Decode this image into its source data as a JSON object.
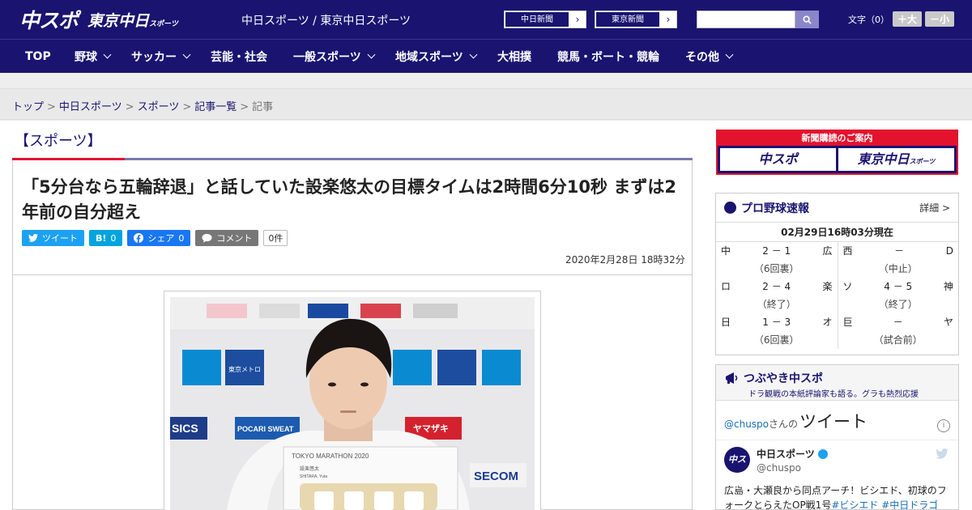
{
  "header": {
    "logo_main": "中スポ",
    "logo_sub": "東京中日",
    "logo_sub_small": "スポーツ",
    "site_title": "中日スポーツ / 東京中日スポーツ",
    "buttons": [
      {
        "label": "中日新聞",
        "arrow": "›"
      },
      {
        "label": "東京新聞",
        "arrow": "›"
      }
    ],
    "search_placeholder": "",
    "font_label": "文字（0）",
    "font_bigger": "＋大",
    "font_smaller": "－小"
  },
  "nav": {
    "items": [
      {
        "label": "TOP",
        "has_menu": false
      },
      {
        "label": "野球",
        "has_menu": true
      },
      {
        "label": "サッカー",
        "has_menu": true
      },
      {
        "label": "芸能・社会",
        "has_menu": false
      },
      {
        "label": "一般スポーツ",
        "has_menu": true
      },
      {
        "label": "地域スポーツ",
        "has_menu": true
      },
      {
        "label": "大相撲",
        "has_menu": false
      },
      {
        "label": "競馬・ボート・競輪",
        "has_menu": false
      },
      {
        "label": "その他",
        "has_menu": true
      }
    ]
  },
  "breadcrumb": {
    "items": [
      "トップ",
      "中日スポーツ",
      "スポーツ",
      "記事一覧"
    ],
    "current": "記事",
    "separator": ">"
  },
  "article": {
    "section": "【スポーツ】",
    "headline": "「5分台なら五輪辞退」と話していた設楽悠太の目標タイムは2時間6分10秒 まずは2年前の自分超え",
    "share": {
      "tweet": "ツイート",
      "hatena": "B!",
      "hatena_count": "0",
      "facebook": "シェア",
      "facebook_count": "0",
      "comment": "コメント",
      "comment_count": "0件"
    },
    "date": "2020年2月28日 18時32分",
    "photo": {
      "backdrop_logos": [
        "SICS",
        "POCARI SWEAT",
        "ヤマザキ",
        "SECOM",
        "東京メトロ"
      ],
      "placard_title": "TOKYO MARATHON 2020",
      "placard_name_jp": "設楽悠太",
      "placard_name_en": "SHITARA, Yuta"
    }
  },
  "sidebar": {
    "ad": {
      "title": "新聞購読のご案内",
      "left": "中スポ",
      "right": "東京中日",
      "right_small": "スポーツ"
    },
    "baseball": {
      "title": "プロ野球速報",
      "more": "詳細 >",
      "as_of": "02月29日16時03分現在",
      "left_games": [
        {
          "home": "中",
          "score": "2 － 1",
          "away": "広",
          "status": "（6回裏）"
        },
        {
          "home": "ロ",
          "score": "2 － 4",
          "away": "楽",
          "status": "（終了）"
        },
        {
          "home": "日",
          "score": "1 － 3",
          "away": "オ",
          "status": "（6回裏）"
        }
      ],
      "right_games": [
        {
          "home": "西",
          "score": "－",
          "away": "D",
          "status": "（中止）"
        },
        {
          "home": "ソ",
          "score": "4 － 5",
          "away": "神",
          "status": "（終了）"
        },
        {
          "home": "巨",
          "score": "－",
          "away": "ヤ",
          "status": "（試合前）"
        }
      ]
    },
    "tsubuyaki": {
      "title": "つぶやき中スポ",
      "subtitle": "ドラ観戦の本紙評論家も語る。グラも熱烈応援",
      "handle": "@chuspo",
      "handle_suffix": "さんの",
      "heading": "ツイート",
      "tweet": {
        "avatar_text": "中スポ",
        "name": "中日スポーツ",
        "screen_name": "@chuspo",
        "text": "広島・大瀬良から同点アーチ！ビシエド、初球のフォークとらえたOP戦1号",
        "tags": [
          "#ビシエド",
          "#中日ドラゴ"
        ]
      }
    }
  }
}
